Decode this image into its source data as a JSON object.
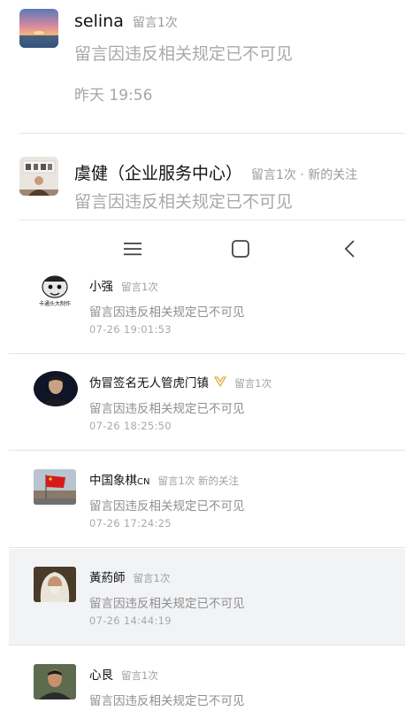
{
  "top_items": [
    {
      "name": "selina",
      "meta": "留言1次",
      "message": "留言因违反相关规定已不可见",
      "time": "昨天 19:56",
      "avatar_icon": "sunset-avatar-icon"
    },
    {
      "name": "虞健（企业服务中心）",
      "meta": "留言1次 · 新的关注",
      "message": "留言因违反相关规定已不可见",
      "avatar_icon": "office-avatar-icon"
    }
  ],
  "nav": {
    "menu_icon": "menu-icon",
    "home_icon": "square-home-icon",
    "back_icon": "back-chevron-icon"
  },
  "list": [
    {
      "name": "小强",
      "meta": "留言1次",
      "message": "留言因违反相关规定已不可见",
      "time": "07-26 19:01:53",
      "avatar_icon": "cartoon-avatar-icon",
      "avatar_caption": "卡通头大制作"
    },
    {
      "name": "伪冒签名无人管虎门镇",
      "badge_icon": "gold-ribbon-icon",
      "meta": "留言1次",
      "message": "留言因违反相关规定已不可见",
      "time": "07-26 18:25:50",
      "avatar_icon": "man-portrait-avatar-icon"
    },
    {
      "name": "中国象棋",
      "name_suffix": "CN",
      "meta": "留言1次 新的关注",
      "message": "留言因违反相关规定已不可见",
      "time": "07-26 17:24:25",
      "avatar_icon": "red-flag-avatar-icon"
    },
    {
      "name": "黃葯師",
      "meta": "留言1次",
      "message": "留言因违反相关规定已不可见",
      "time": "07-26 14:44:19",
      "avatar_icon": "old-man-avatar-icon",
      "selected": true
    },
    {
      "name": "心艮",
      "meta": "留言1次",
      "message": "留言因违反相关规定已不可见",
      "avatar_icon": "young-man-avatar-icon"
    }
  ],
  "colors": {
    "selected_row_bg": "#f2f3f5",
    "muted_text": "#a9a9a9",
    "badge_gold": "#e0b040"
  }
}
